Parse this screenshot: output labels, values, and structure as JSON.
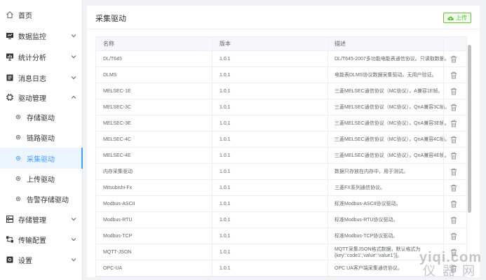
{
  "sidebar": {
    "items": [
      {
        "label": "首页",
        "icon": "home-icon"
      },
      {
        "label": "数据监控",
        "icon": "monitor-icon"
      },
      {
        "label": "统计分析",
        "icon": "chart-icon"
      },
      {
        "label": "消息日志",
        "icon": "log-icon"
      },
      {
        "label": "驱动管理",
        "icon": "chip-icon"
      },
      {
        "label": "存储驱动",
        "icon": "gear-icon"
      },
      {
        "label": "链路驱动",
        "icon": "gear-icon"
      },
      {
        "label": "采集驱动",
        "icon": "gear-icon"
      },
      {
        "label": "上传驱动",
        "icon": "gear-icon"
      },
      {
        "label": "告警存储驱动",
        "icon": "gear-icon"
      },
      {
        "label": "存储管理",
        "icon": "storage-icon"
      },
      {
        "label": "传输配置",
        "icon": "transfer-icon"
      },
      {
        "label": "设置",
        "icon": "settings-icon"
      }
    ]
  },
  "main": {
    "title": "采集驱动",
    "upload_label": "上传",
    "columns": [
      "名称",
      "版本",
      "描述"
    ],
    "rows": [
      {
        "name": "DL/T645",
        "version": "1.0.1",
        "desc": "DL/T645-2007多功能电能表通信协议。只读取数据。"
      },
      {
        "name": "DLMS",
        "version": "1.0.1",
        "desc": "电能表DLMS协议数据采集驱动。无用户验证。"
      },
      {
        "name": "MELSEC-1E",
        "version": "1.0.1",
        "desc": "三菱MELSEC通信协议（MC协议），A兼容1E帧。"
      },
      {
        "name": "MELSEC-3C",
        "version": "1.0.1",
        "desc": "三菱MELSEC通信协议（MC协议），QnA兼容3C帧。"
      },
      {
        "name": "MELSEC-3E",
        "version": "1.0.1",
        "desc": "三菱MELSEC通信协议（MC协议），QnA兼容3E帧。"
      },
      {
        "name": "MELSEC-4C",
        "version": "1.0.1",
        "desc": "三菱MELSEC通信协议（MC协议），QnA兼容4C帧。"
      },
      {
        "name": "MELSEC-4E",
        "version": "1.0.1",
        "desc": "三菱MELSEC通信协议（MC协议），QnA兼容4E帧。"
      },
      {
        "name": "内存采集驱动",
        "version": "1.0.1",
        "desc": "数据只存放在内存中，用于测试。"
      },
      {
        "name": "Mitsubishi-Fx",
        "version": "1.0.1",
        "desc": "三菱FX系列通信协议。"
      },
      {
        "name": "Modbus-ASCII",
        "version": "1.0.1",
        "desc": "标准Modbus-ASCII协议驱动。"
      },
      {
        "name": "Modbus-RTU",
        "version": "1.0.1",
        "desc": "标准Modbus-RTU协议驱动。"
      },
      {
        "name": "Modbus-TCP",
        "version": "1.0.1",
        "desc": "标准Modbus-TCP协议驱动。"
      },
      {
        "name": "MQTT-JSON",
        "version": "1.0.1",
        "desc": "MQTT采集JSON格式数据，默认格式为{key':'code1','value':'value1'}]。"
      },
      {
        "name": "OPC-UA",
        "version": "1.0.1",
        "desc": "OPC UA客户端采集通信协议。"
      }
    ]
  },
  "watermark": {
    "line1": "yiqi.com",
    "line2": "仪器网"
  },
  "colors": {
    "accent": "#409eff",
    "success": "#67c23a"
  }
}
